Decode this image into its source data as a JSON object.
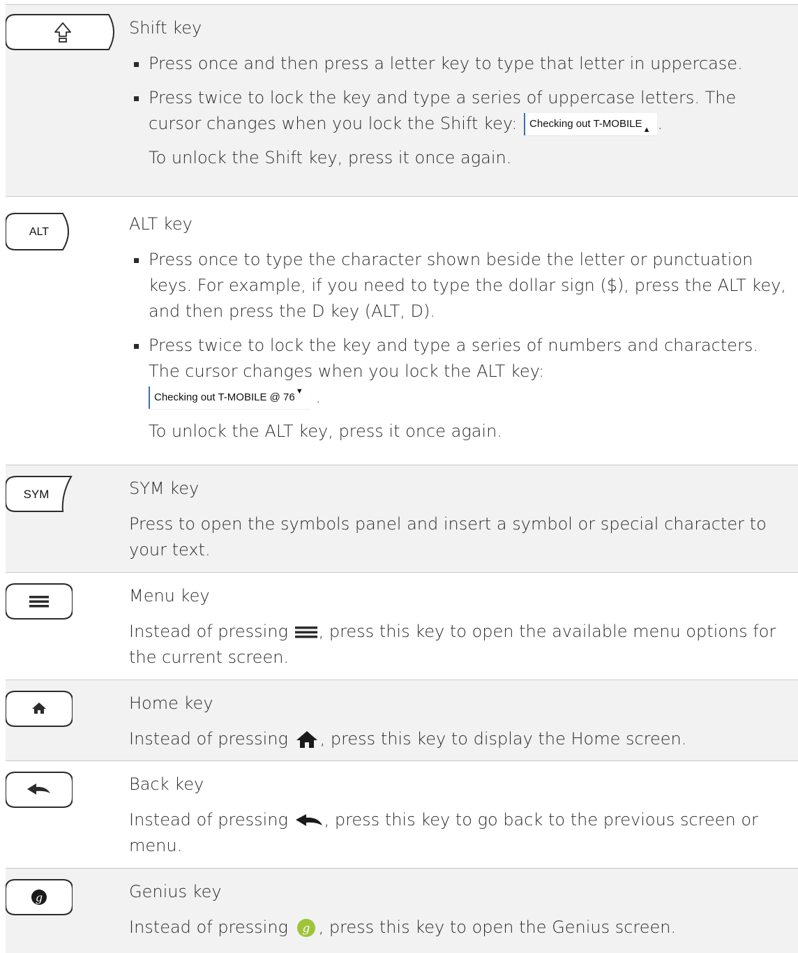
{
  "rows": [
    {
      "key_label": "",
      "key_icon": "shift-arrow-icon",
      "title": "Shift key",
      "bullets": [
        "Press once and then press a letter key to type that letter in uppercase.",
        "Press twice to lock the key and type a series of uppercase letters. The cursor changes when you lock the Shift key:"
      ],
      "cursor_sample": "Checking out T-MOBILE",
      "note": "To unlock the Shift key, press it once again."
    },
    {
      "key_label": "ALT",
      "title": "ALT key",
      "bullets": [
        "Press once to type the character shown beside the letter or punctuation keys. For example, if you need to type the dollar sign ($), press the ALT key, and then press the D key (ALT, D).",
        "Press twice to lock the key and type a series of numbers and characters. The cursor changes when you lock the ALT key:"
      ],
      "cursor_sample": "Checking out T-MOBILE @ 76",
      "note": "To unlock the ALT key, press it once again."
    },
    {
      "key_label": "SYM",
      "title": "SYM key",
      "description": "Press to open the symbols panel and insert a symbol or special character to your text."
    },
    {
      "key_icon": "menu-icon",
      "title": "Menu key",
      "description_before": "Instead of pressing",
      "description_after": ", press this key to open the available menu options for the current screen."
    },
    {
      "key_icon": "home-icon",
      "title": "Home key",
      "description_before": "Instead of pressing",
      "description_after": ", press this key to display the Home screen."
    },
    {
      "key_icon": "back-arrow-icon",
      "title": "Back key",
      "description_before": "Instead of pressing",
      "description_after": ", press this key to go back to the previous screen or menu."
    },
    {
      "key_icon": "genius-icon",
      "title": "Genius key",
      "description_before": "Instead of pressing",
      "description_after": ", press this key to open the Genius screen.",
      "genius_color": "#9fc43a"
    }
  ]
}
